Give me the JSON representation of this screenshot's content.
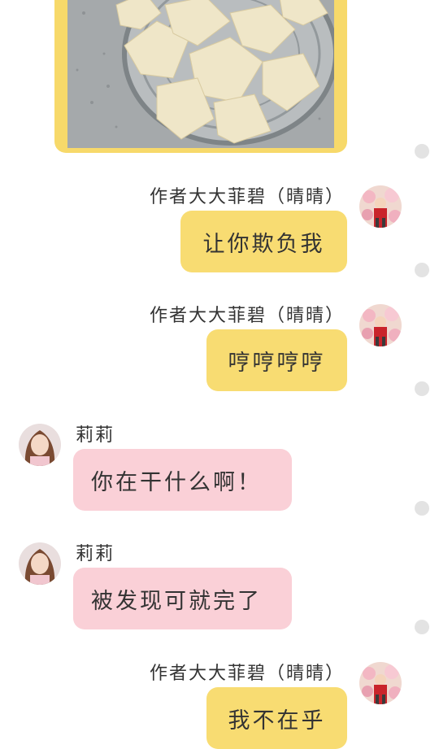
{
  "messages": [
    {
      "sender": "作者大大菲碧（晴晴）",
      "text": "让你欺负我"
    },
    {
      "sender": "作者大大菲碧（晴晴）",
      "text": "哼哼哼哼"
    },
    {
      "sender": "莉莉",
      "text": "你在干什么啊！"
    },
    {
      "sender": "莉莉",
      "text": "被发现可就完了"
    },
    {
      "sender": "作者大大菲碧（晴晴）",
      "text": "我不在乎"
    }
  ],
  "colors": {
    "outgoing_bubble": "#f8dc72",
    "incoming_bubble": "#fad0d7",
    "dot": "#e3e3e3"
  }
}
